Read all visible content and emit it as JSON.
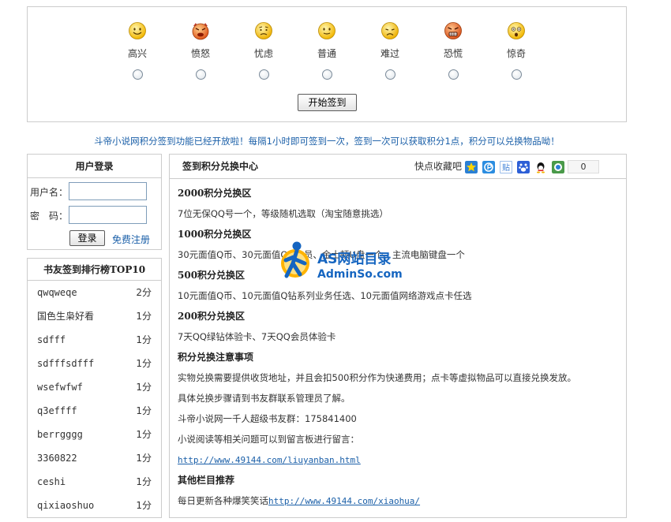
{
  "moods": [
    {
      "label": "高兴",
      "icon": "smile-icon"
    },
    {
      "label": "愤怒",
      "icon": "angry-icon"
    },
    {
      "label": "忧虑",
      "icon": "worried-icon"
    },
    {
      "label": "普通",
      "icon": "neutral-icon"
    },
    {
      "label": "难过",
      "icon": "sad-icon"
    },
    {
      "label": "恐慌",
      "icon": "panic-icon"
    },
    {
      "label": "惊奇",
      "icon": "surprised-icon"
    }
  ],
  "checkin_button": "开始签到",
  "notice": "斗帝小说网积分签到功能已经开放啦！每隔1小时即可签到一次，签到一次可以获取积分1点，积分可以兑换物品呦！",
  "login": {
    "title": "用户登录",
    "username_label": "用户名：",
    "password_label": "密　码：",
    "username_value": "",
    "password_value": "",
    "submit": "登录",
    "register": "免费注册"
  },
  "ranking": {
    "title": "书友签到排行榜TOP10",
    "rows": [
      {
        "name": "qwqweqe",
        "score": "2分"
      },
      {
        "name": "国色生枭好看",
        "score": "1分"
      },
      {
        "name": "sdfff",
        "score": "1分"
      },
      {
        "name": "sdfffsdfff",
        "score": "1分"
      },
      {
        "name": "wsefwfwf",
        "score": "1分"
      },
      {
        "name": "q3effff",
        "score": "1分"
      },
      {
        "name": "berrgggg",
        "score": "1分"
      },
      {
        "name": "3360822",
        "score": "1分"
      },
      {
        "name": "ceshi",
        "score": "1分"
      },
      {
        "name": "qixiaoshuo",
        "score": "1分"
      }
    ]
  },
  "exchange": {
    "title": "签到积分兑换中心",
    "bookmark_label": "快点收藏吧",
    "share_icons": [
      "qzone-icon",
      "pengyou-icon",
      "tieba-icon",
      "baidu-icon",
      "qq-icon",
      "bookmark-icon"
    ],
    "share_count": "0",
    "lines": [
      {
        "text": "2000积分兑换区",
        "kind": "heading"
      },
      {
        "text": "7位无保QQ号一个，等级随机选取（淘宝随意挑选）",
        "kind": "text"
      },
      {
        "text": "1000积分兑换区",
        "kind": "heading"
      },
      {
        "text": "30元面值Q币、30元面值QQ会员、金士顿U盘一个、主流电脑键盘一个",
        "kind": "text"
      },
      {
        "text": "500积分兑换区",
        "kind": "heading"
      },
      {
        "text": "10元面值Q币、10元面值Q钻系列业务任选、10元面值网络游戏点卡任选",
        "kind": "text"
      },
      {
        "text": "200积分兑换区",
        "kind": "heading"
      },
      {
        "text": "7天QQ绿钻体验卡、7天QQ会员体验卡",
        "kind": "text"
      },
      {
        "text": "积分兑换注意事项",
        "kind": "heading"
      },
      {
        "text": "实物兑换需要提供收货地址，并且会扣500积分作为快递费用；点卡等虚拟物品可以直接兑换发放。",
        "kind": "text"
      },
      {
        "text": "具体兑换步骤请到书友群联系管理员了解。",
        "kind": "text"
      },
      {
        "text": "斗帝小说网一千人超级书友群：175841400",
        "kind": "text"
      },
      {
        "text": "小说阅读等相关问题可以到留言板进行留言：",
        "kind": "text"
      },
      {
        "text": "http://www.49144.com/liuyanban.html",
        "kind": "link"
      },
      {
        "text": "其他栏目推荐",
        "kind": "heading"
      },
      {
        "text": "每日更新各种爆笑笑话",
        "kind": "text",
        "link": "http://www.49144.com/xiaohua/"
      }
    ]
  },
  "watermark": {
    "line1": "AS网站目录",
    "line2": "AdminSo.com"
  },
  "colors": {
    "accent": "#1a5fa8",
    "border": "#cccccc",
    "watermark": "#1565c0"
  }
}
